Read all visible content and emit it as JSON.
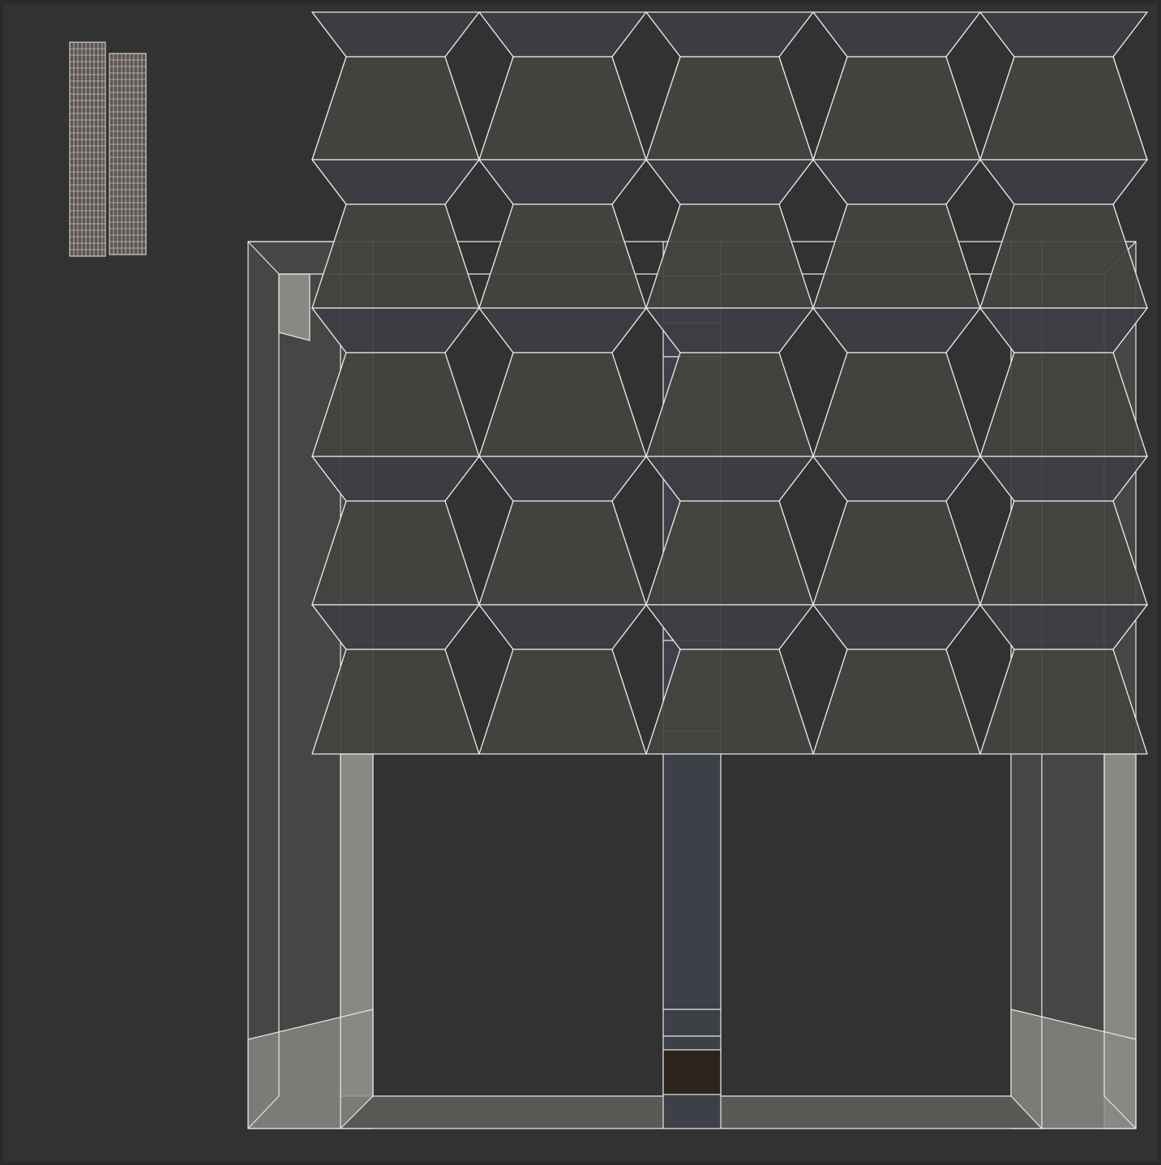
{
  "colors": {
    "frame": "#2a2a2a",
    "canvas": "#323232",
    "wire": "#e8e8e8",
    "panel_face": "#45433f",
    "panel_band": "#3c3e44",
    "leg_light": "#8a8884",
    "leg_mid": "#5a5956",
    "strip_blue": "#3e4047",
    "strip_dark": "#2c241b",
    "small_uv": "#5d5552"
  },
  "grid": {
    "rows": 5,
    "cols": 5
  }
}
